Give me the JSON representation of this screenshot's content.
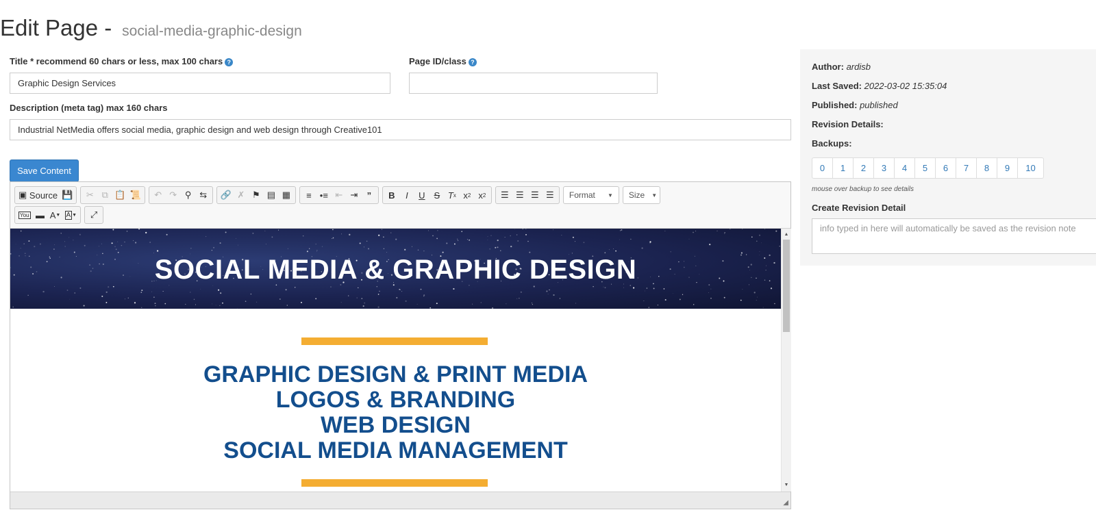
{
  "heading": {
    "title": "Edit Page -",
    "slug": "social-media-graphic-design"
  },
  "form": {
    "title_label": "Title * recommend 60 chars or less, max 100 chars",
    "title_value": "Graphic Design Services",
    "pageid_label": "Page ID/class",
    "pageid_value": "",
    "description_label": "Description (meta tag) max 160 chars",
    "description_value": "Industrial NetMedia offers social media, graphic design and web design through Creative101",
    "save_label": "Save Content"
  },
  "toolbar": {
    "source_label": "Source",
    "format_label": "Format",
    "size_label": "Size"
  },
  "content": {
    "banner_title": "SOCIAL MEDIA & GRAPHIC DESIGN",
    "services": [
      "GRAPHIC DESIGN & PRINT MEDIA",
      "LOGOS & BRANDING",
      "WEB DESIGN",
      "SOCIAL MEDIA MANAGEMENT"
    ]
  },
  "sidebar": {
    "author_label": "Author:",
    "author_value": "ardisb",
    "last_saved_label": "Last Saved:",
    "last_saved_value": "2022-03-02 15:35:04",
    "published_label": "Published:",
    "published_value": "published",
    "revision_details_label": "Revision Details:",
    "backups_label": "Backups:",
    "backups": [
      "0",
      "1",
      "2",
      "3",
      "4",
      "5",
      "6",
      "7",
      "8",
      "9",
      "10"
    ],
    "backup_hint": "mouse over backup to see details",
    "create_revision_label": "Create Revision Detail",
    "revision_placeholder": "info typed in here will automatically be saved as the revision note"
  },
  "colors": {
    "primary_button": "#3a87d0",
    "link": "#337ab7",
    "service_text": "#134e8d",
    "accent_bar": "#f4ad32",
    "banner_bg": "#1b2350"
  }
}
